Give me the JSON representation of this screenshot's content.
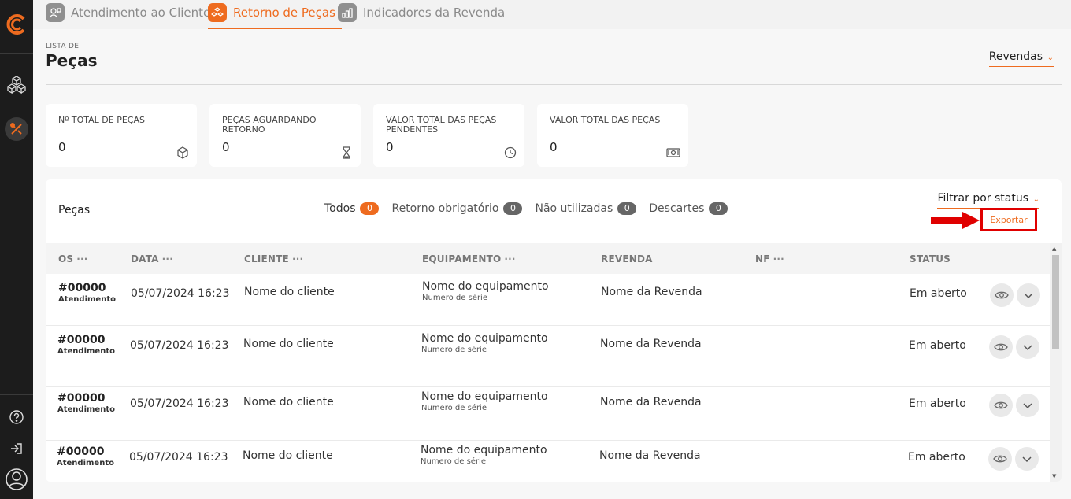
{
  "sidebar": {
    "icons": [
      "logo-icon",
      "cubes-icon",
      "tools-icon",
      "help-icon",
      "logout-icon",
      "user-avatar-icon"
    ]
  },
  "tabs": [
    {
      "label": "Atendimento ao Cliente",
      "icon": "support-icon",
      "active": false
    },
    {
      "label": "Retorno de Peças",
      "icon": "parts-icon",
      "active": true
    },
    {
      "label": "Indicadores da Revenda",
      "icon": "chart-icon",
      "active": false
    }
  ],
  "page": {
    "kicker": "LISTA DE",
    "title": "Peças",
    "revendas_label": "Revendas"
  },
  "cards": [
    {
      "label": "Nº TOTAL DE PEÇAS",
      "value": "0",
      "icon": "cube-icon"
    },
    {
      "label": "PEÇAS AGUARDANDO RETORNO",
      "value": "0",
      "icon": "hourglass-icon"
    },
    {
      "label": "VALOR TOTAL DAS PEÇAS PENDENTES",
      "value": "0",
      "icon": "clock-icon"
    },
    {
      "label": "VALOR TOTAL DAS PEÇAS",
      "value": "0",
      "icon": "money-icon"
    }
  ],
  "panel": {
    "title": "Peças",
    "filters": [
      {
        "label": "Todos",
        "count": "0"
      },
      {
        "label": "Retorno obrigatório",
        "count": "0"
      },
      {
        "label": "Não utilizadas",
        "count": "0"
      },
      {
        "label": "Descartes",
        "count": "0"
      }
    ],
    "status_filter": "Filtrar por status",
    "export_label": "Exportar"
  },
  "table": {
    "columns": [
      "OS",
      "DATA",
      "CLIENTE",
      "EQUIPAMENTO",
      "REVENDA",
      "NF",
      "STATUS"
    ],
    "rows": [
      {
        "os": "#00000",
        "os_sub": "Atendimento",
        "data": "05/07/2024 16:23",
        "cliente": "Nome do cliente",
        "equipamento": "Nome do equipamento",
        "serie": "Numero de série",
        "revenda": "Nome da Revenda",
        "nf": "",
        "status": "Em aberto"
      },
      {
        "os": "#00000",
        "os_sub": "Atendimento",
        "data": "05/07/2024 16:23",
        "cliente": "Nome do cliente",
        "equipamento": "Nome do equipamento",
        "serie": "Numero de série",
        "revenda": "Nome da Revenda",
        "nf": "",
        "status": "Em aberto"
      },
      {
        "os": "#00000",
        "os_sub": "Atendimento",
        "data": "05/07/2024 16:23",
        "cliente": "Nome do cliente",
        "equipamento": "Nome do equipamento",
        "serie": "Numero de série",
        "revenda": "Nome da Revenda",
        "nf": "",
        "status": "Em aberto"
      },
      {
        "os": "#00000",
        "os_sub": "Atendimento",
        "data": "05/07/2024 16:23",
        "cliente": "Nome do cliente",
        "equipamento": "Nome do equipamento",
        "serie": "Numero de série",
        "revenda": "Nome da Revenda",
        "nf": "",
        "status": "Em aberto"
      }
    ]
  },
  "colors": {
    "accent": "#ee6b1f",
    "sidebar": "#1c1c1c",
    "highlight_red": "#e00000"
  }
}
